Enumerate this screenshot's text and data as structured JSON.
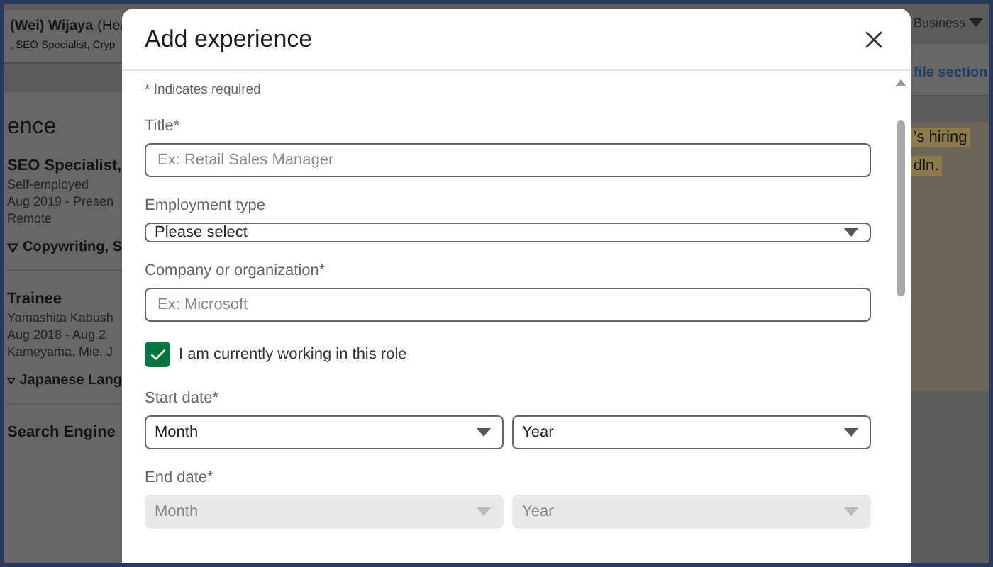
{
  "background": {
    "profile": {
      "name": "(Wei) Wijaya",
      "pronouns": "(He/",
      "headline": ", SEO Specialist, Cryp"
    },
    "section_title": "ence",
    "entries": [
      {
        "title": "SEO Specialist,",
        "lines": [
          "Self-employed",
          "Aug 2019 - Presen",
          "Remote"
        ],
        "skills": "Copywriting, S"
      },
      {
        "title": "Trainee",
        "lines": [
          "Yamashita Kabush",
          "Aug 2018 - Aug 2",
          "Kameyama, Mie, J"
        ],
        "skills": "Japanese Lang"
      }
    ],
    "next_entry": "Search Engine",
    "right": {
      "menu": "Business",
      "link": "file section",
      "ad_lines": [
        "’s hiring",
        "dln."
      ]
    }
  },
  "modal": {
    "title": "Add experience",
    "note": "* Indicates required",
    "fields": [
      {
        "kind": "input",
        "label": "Title*",
        "placeholder": "Ex: Retail Sales Manager"
      },
      {
        "kind": "select",
        "label": "Employment type",
        "value": "Please select"
      },
      {
        "kind": "input",
        "label": "Company or organization*",
        "placeholder": "Ex: Microsoft"
      },
      {
        "kind": "checkbox",
        "label": "I am currently working in this role",
        "checked": true
      },
      {
        "kind": "date",
        "label": "Start date*",
        "selects": [
          {
            "value": "Month",
            "disabled": false
          },
          {
            "value": "Year",
            "disabled": false
          }
        ]
      },
      {
        "kind": "date",
        "label": "End date*",
        "selects": [
          {
            "value": "Month",
            "disabled": true
          },
          {
            "value": "Year",
            "disabled": true
          }
        ]
      }
    ]
  }
}
